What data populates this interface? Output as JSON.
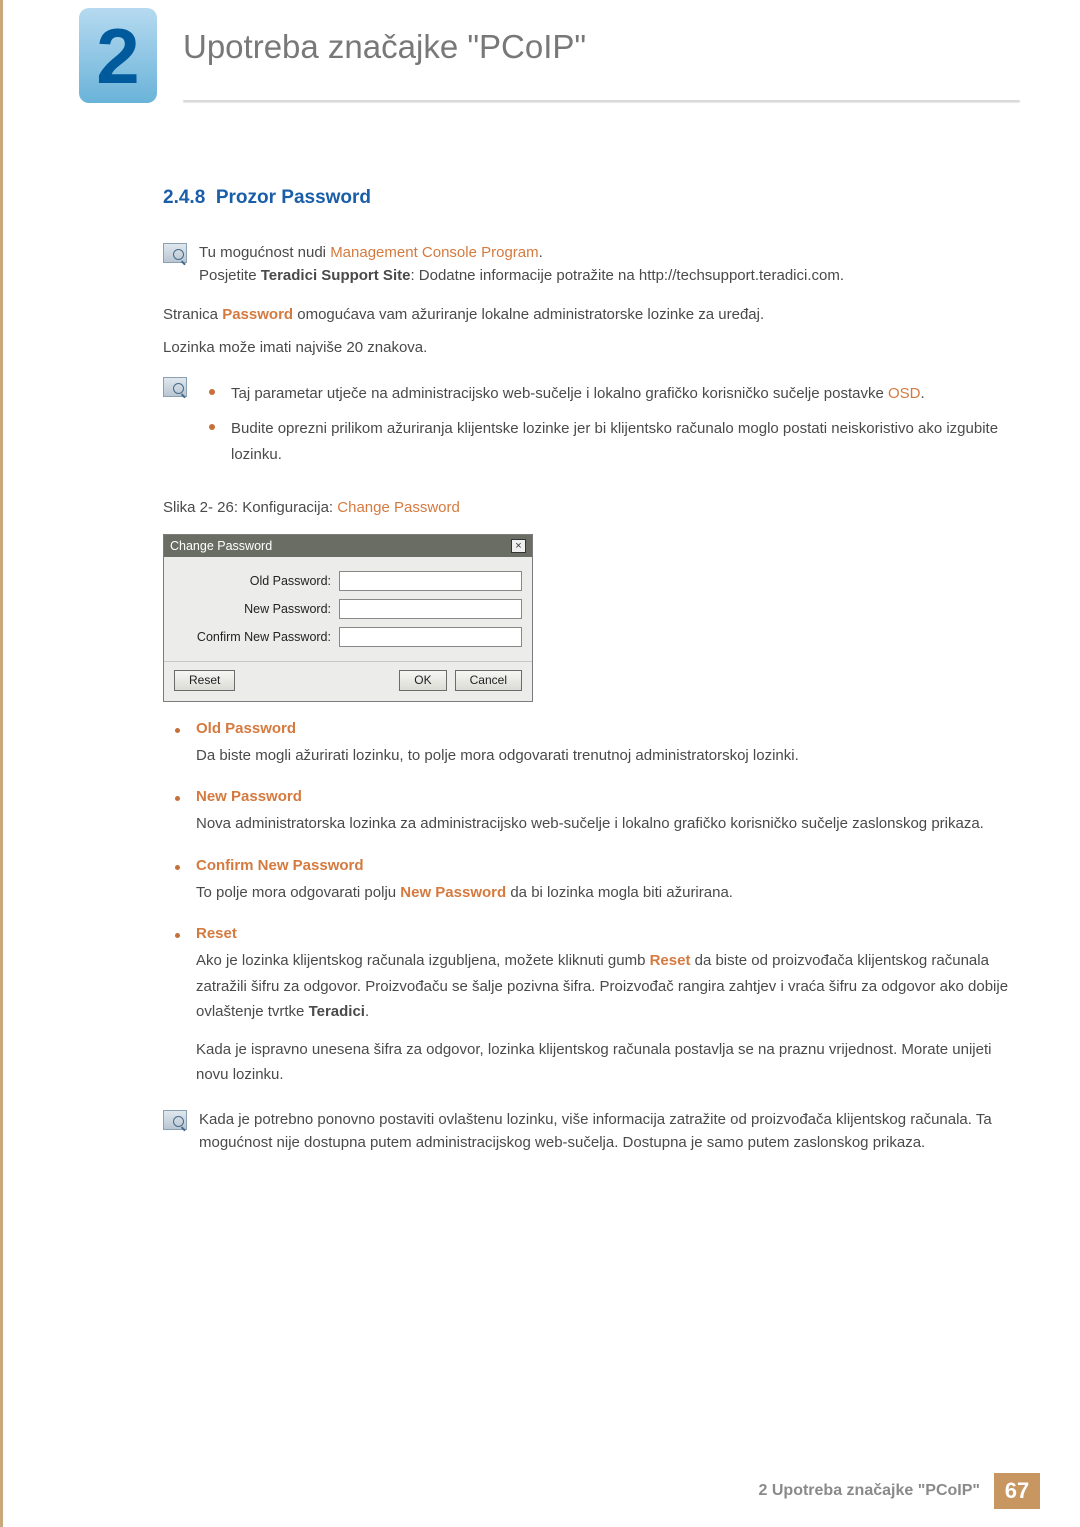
{
  "chapter": {
    "number": "2",
    "title": "Upotreba značajke \"PCoIP\""
  },
  "section": {
    "number": "2.4.8",
    "title": "Prozor Password"
  },
  "note1": {
    "line1_pre": "Tu mogućnost nudi ",
    "line1_link": "Management Console Program",
    "line1_post": ".",
    "line2_pre": "Posjetite ",
    "line2_bold": "Teradici Support Site",
    "line2_post": ": Dodatne informacije potražite na http://techsupport.teradici.com."
  },
  "body1_pre": "Stranica ",
  "body1_kw": "Password",
  "body1_post": " omogućava vam ažuriranje lokalne administratorske lozinke za uređaj.",
  "body2": "Lozinka može imati najviše 20 znakova.",
  "note2": {
    "b1_pre": "Taj parametar utječe na administracijsko web-sučelje i lokalno grafičko korisničko sučelje postavke ",
    "b1_kw": "OSD",
    "b1_post": ".",
    "b2": "Budite oprezni prilikom ažuriranja klijentske lozinke jer bi klijentsko računalo moglo postati neiskoristivo ako izgubite lozinku."
  },
  "figure": {
    "pre": "Slika 2- 26: Konfiguracija: ",
    "kw": "Change Password"
  },
  "dialog": {
    "title": "Change Password",
    "close": "×",
    "old": "Old Password:",
    "new": "New Password:",
    "confirm": "Confirm New Password:",
    "reset": "Reset",
    "ok": "OK",
    "cancel": "Cancel"
  },
  "defs": {
    "old": {
      "title": "Old Password",
      "text": "Da biste mogli ažurirati lozinku, to polje mora odgovarati trenutnoj administratorskoj lozinki."
    },
    "new": {
      "title": "New Password",
      "text": "Nova administratorska lozinka za administracijsko web-sučelje i lokalno grafičko korisničko sučelje zaslonskog prikaza."
    },
    "confirm": {
      "title": "Confirm New Password",
      "text_pre": "To polje mora odgovarati polju ",
      "text_kw": "New Password",
      "text_post": " da bi lozinka mogla biti ažurirana."
    },
    "reset": {
      "title": "Reset",
      "p1_pre": "Ako je lozinka klijentskog računala izgubljena, možete kliknuti gumb ",
      "p1_kw": "Reset",
      "p1_mid": " da biste od proizvođača klijentskog računala zatražili šifru za odgovor. Proizvođaču se šalje pozivna šifra. Proizvođač rangira zahtjev i vraća šifru za odgovor ako dobije ovlaštenje tvrtke ",
      "p1_bold": "Teradici",
      "p1_post": ".",
      "p2": "Kada je ispravno unesena šifra za odgovor, lozinka klijentskog računala postavlja se na praznu vrijednost. Morate unijeti novu lozinku."
    }
  },
  "note3": "Kada je potrebno ponovno postaviti ovlaštenu lozinku, više informacija zatražite od proizvođača klijentskog računala. Ta mogućnost nije dostupna putem administracijskog web-sučelja. Dostupna je samo putem zaslonskog prikaza.",
  "footer": {
    "text": "2 Upotreba značajke \"PCoIP\"",
    "page": "67"
  }
}
